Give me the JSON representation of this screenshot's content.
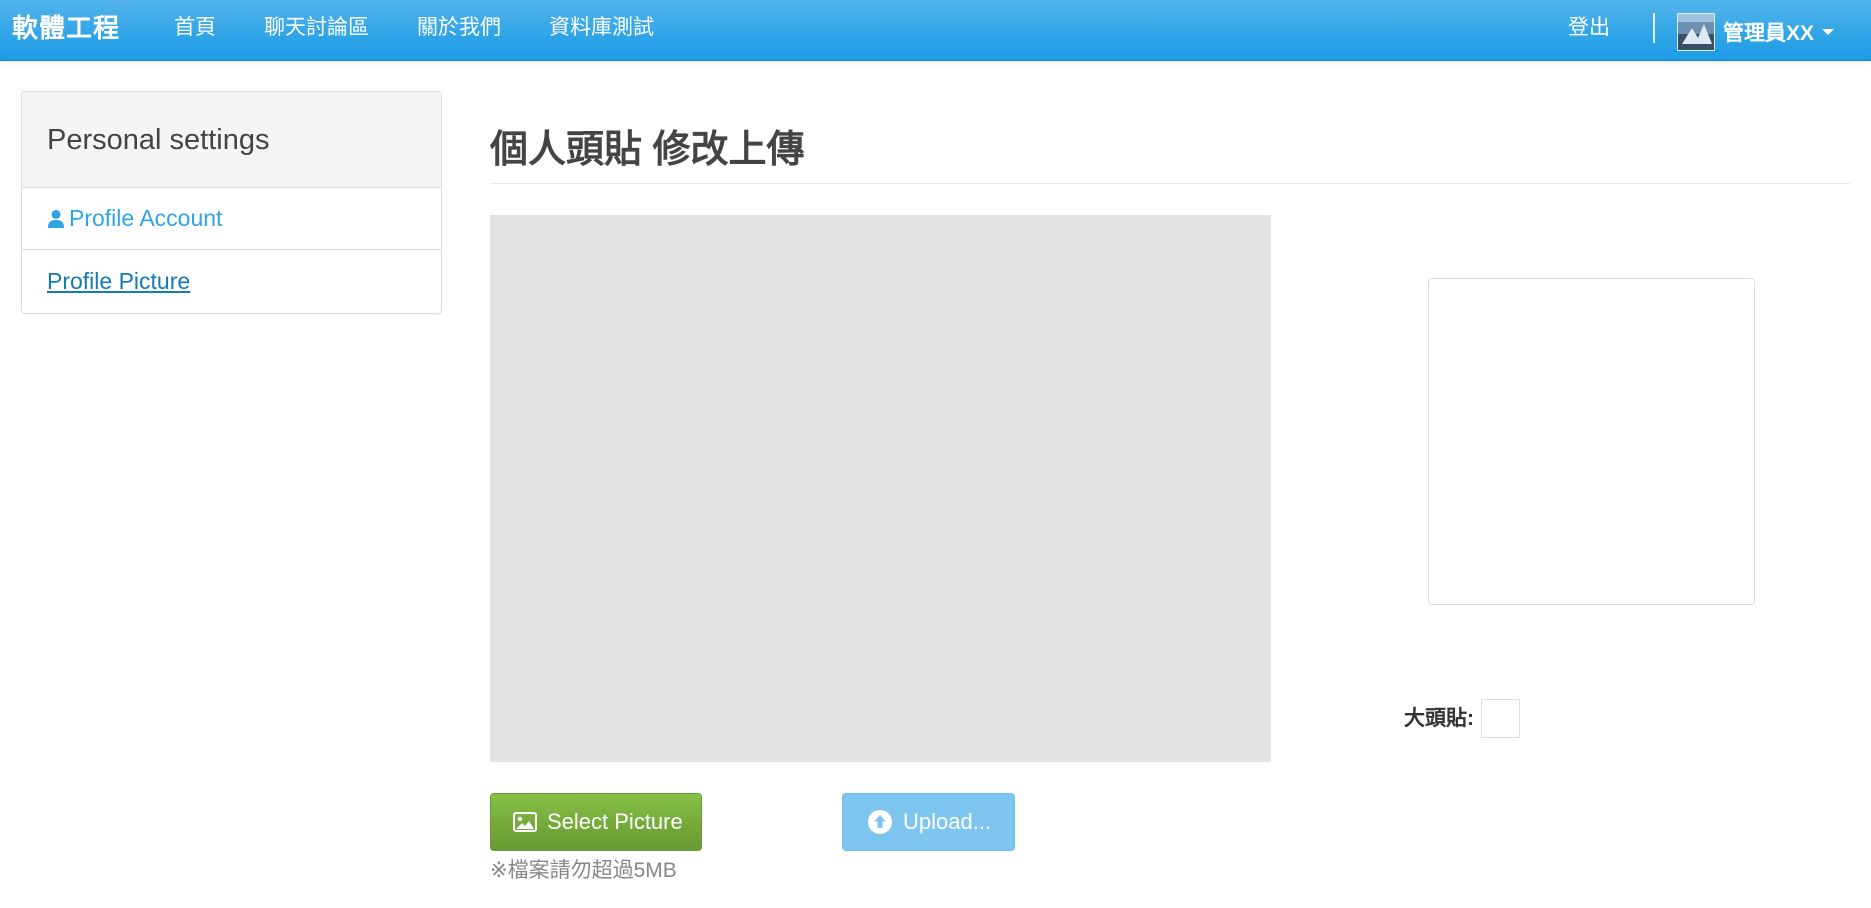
{
  "navbar": {
    "brand": "軟體工程",
    "links": [
      "首頁",
      "聊天討論區",
      "關於我們",
      "資料庫測試"
    ],
    "logout": "登出",
    "user_name": "管理員XX"
  },
  "sidebar": {
    "title": "Personal settings",
    "items": [
      {
        "label": "Profile Account",
        "icon": "user-icon"
      },
      {
        "label": "Profile Picture"
      }
    ]
  },
  "main": {
    "title": "個人頭貼 修改上傳",
    "big_avatar_label": "大頭貼:",
    "select_button": "Select Picture",
    "upload_button": "Upload...",
    "hint": "※檔案請勿超過5MB"
  },
  "colors": {
    "navbar": "#2fa4e7",
    "link": "#2fa4e7",
    "success": "#73a839",
    "upload_disabled": "#7dc5ef"
  }
}
